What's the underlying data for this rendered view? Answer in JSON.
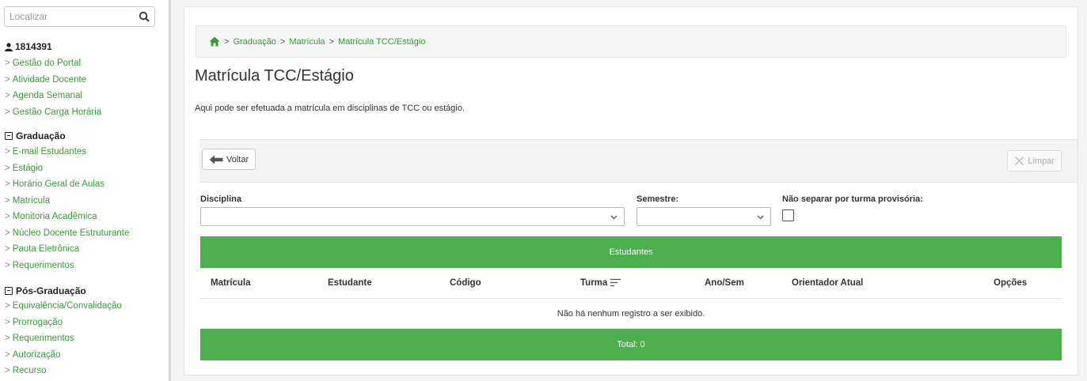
{
  "sidebar": {
    "search_placeholder": "Localizar",
    "user_id": "1814391",
    "user_items": [
      "Gestão do Portal",
      "Atividade Docente",
      "Agenda Semanal",
      "Gestão Carga Horária"
    ],
    "graduacao_title": "Graduação",
    "graduacao_items": [
      "E-mail Estudantes",
      "Estágio",
      "Horário Geral de Aulas",
      "Matrícula",
      "Monitoria Acadêmica",
      "Núcleo Docente Estruturante",
      "Pauta Eletrônica",
      "Requerimentos"
    ],
    "pos_title": "Pós-Graduação",
    "pos_items": [
      "Equivalência/Convalidação",
      "Prorrogação",
      "Requerimentos",
      "Autorização",
      "Recurso"
    ]
  },
  "breadcrumb": [
    "Graduação",
    "Matrícula",
    "Matrícula TCC/Estágio"
  ],
  "page": {
    "title": "Matrícula TCC/Estágio",
    "description": "Aqui pode ser efetuada a matrícula em disciplinas de TCC ou estágio."
  },
  "toolbar": {
    "back_label": "Voltar",
    "clear_label": "Limpar"
  },
  "form": {
    "disciplina_label": "Disciplina",
    "disciplina_value": "",
    "semestre_label": "Semestre:",
    "semestre_value": "",
    "nao_separar_label": "Não separar por turma provisória:"
  },
  "table": {
    "title": "Estudantes",
    "columns": [
      "Matrícula",
      "Estudante",
      "Código",
      "Turma",
      "Ano/Sem",
      "Orientador Atual",
      "Opções"
    ],
    "empty_message": "Não há nenhum registro a ser exibido.",
    "total": "Total: 0"
  },
  "colors": {
    "accent": "#4cae4c",
    "link": "#3a9a3a"
  }
}
